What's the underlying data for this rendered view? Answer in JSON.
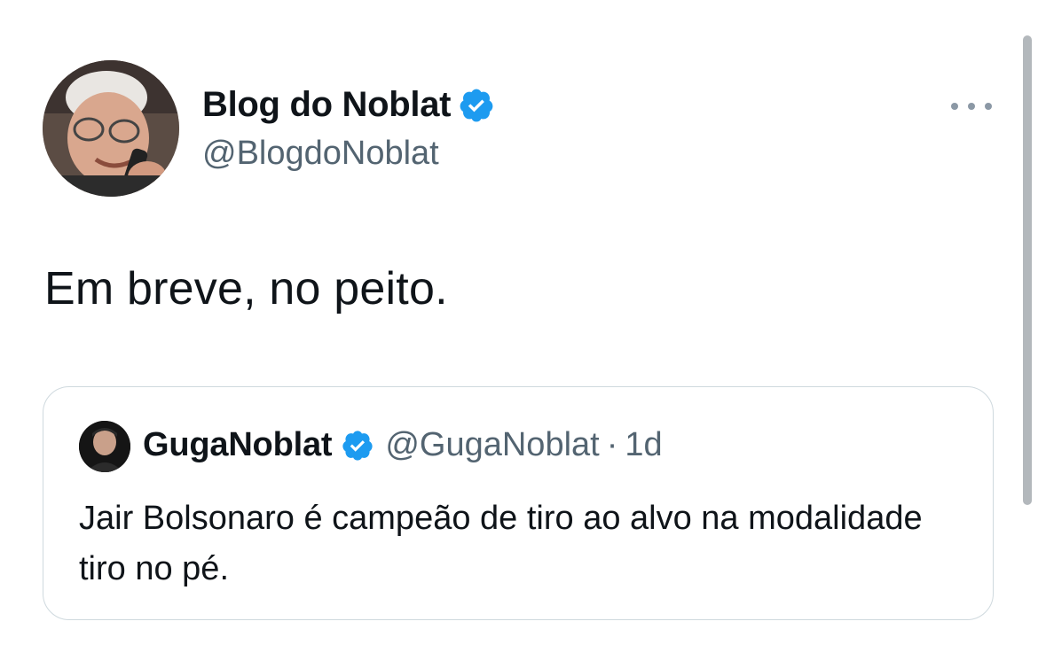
{
  "tweet": {
    "author": {
      "display_name": "Blog do Noblat",
      "handle": "@BlogdoNoblat",
      "verified": true
    },
    "text": "Em breve, no peito.",
    "more_icon": "more-horizontal-icon"
  },
  "quoted_tweet": {
    "author": {
      "display_name": "GugaNoblat",
      "handle": "@GugaNoblat",
      "verified": true
    },
    "separator": "·",
    "time": "1d",
    "text": "Jair Bolsonaro é campeão de tiro ao alvo na modalidade tiro no pé."
  },
  "colors": {
    "verified_blue": "#1d9bf0",
    "text_primary": "#0f1419",
    "text_secondary": "#536471",
    "border": "#cfd9de"
  }
}
